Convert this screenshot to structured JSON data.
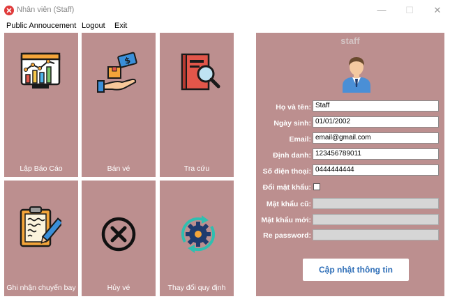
{
  "window": {
    "title": "Nhân viên (Staff)",
    "controls": {
      "minimize": "—",
      "maximize": "☐",
      "close": "✕"
    }
  },
  "menu": {
    "public": "Public Annoucement",
    "logout": "Logout",
    "exit": "Exit"
  },
  "tiles": [
    {
      "label": "Lập Báo Cáo",
      "icon": "report-chart-icon"
    },
    {
      "label": "Bán vé",
      "icon": "sell-ticket-icon"
    },
    {
      "label": "Tra cứu",
      "icon": "book-search-icon"
    },
    {
      "label": "Ghi nhận chuyến bay",
      "icon": "clipboard-pen-icon"
    },
    {
      "label": "Hủy vé",
      "icon": "cancel-x-icon"
    },
    {
      "label": "Thay đổi quy định",
      "icon": "gear-refresh-icon"
    }
  ],
  "profile": {
    "title": "staff",
    "fields": {
      "name_label": "Họ và tên:",
      "name_value": "Staff",
      "birth_label": "Ngày sinh:",
      "birth_value": "01/01/2002",
      "email_label": "Email:",
      "email_value": "email@gmail.com",
      "id_label": "Định danh:",
      "id_value": "123456789011",
      "phone_label": "Số điện thoại:",
      "phone_value": "0444444444",
      "change_pw_label": "Đổi mật khẩu:",
      "change_pw_checked": false,
      "old_pw_label": "Mật khẩu cũ:",
      "old_pw_value": "",
      "new_pw_label": "Mật khẩu mới:",
      "new_pw_value": "",
      "repw_label": "Re password:",
      "repw_value": ""
    },
    "update_button": "Cập nhật thông tin"
  },
  "colors": {
    "tile_bg": "#bc8f8f",
    "panel_bg": "#bc8f8f",
    "accent_text": "#2f6fb8"
  }
}
